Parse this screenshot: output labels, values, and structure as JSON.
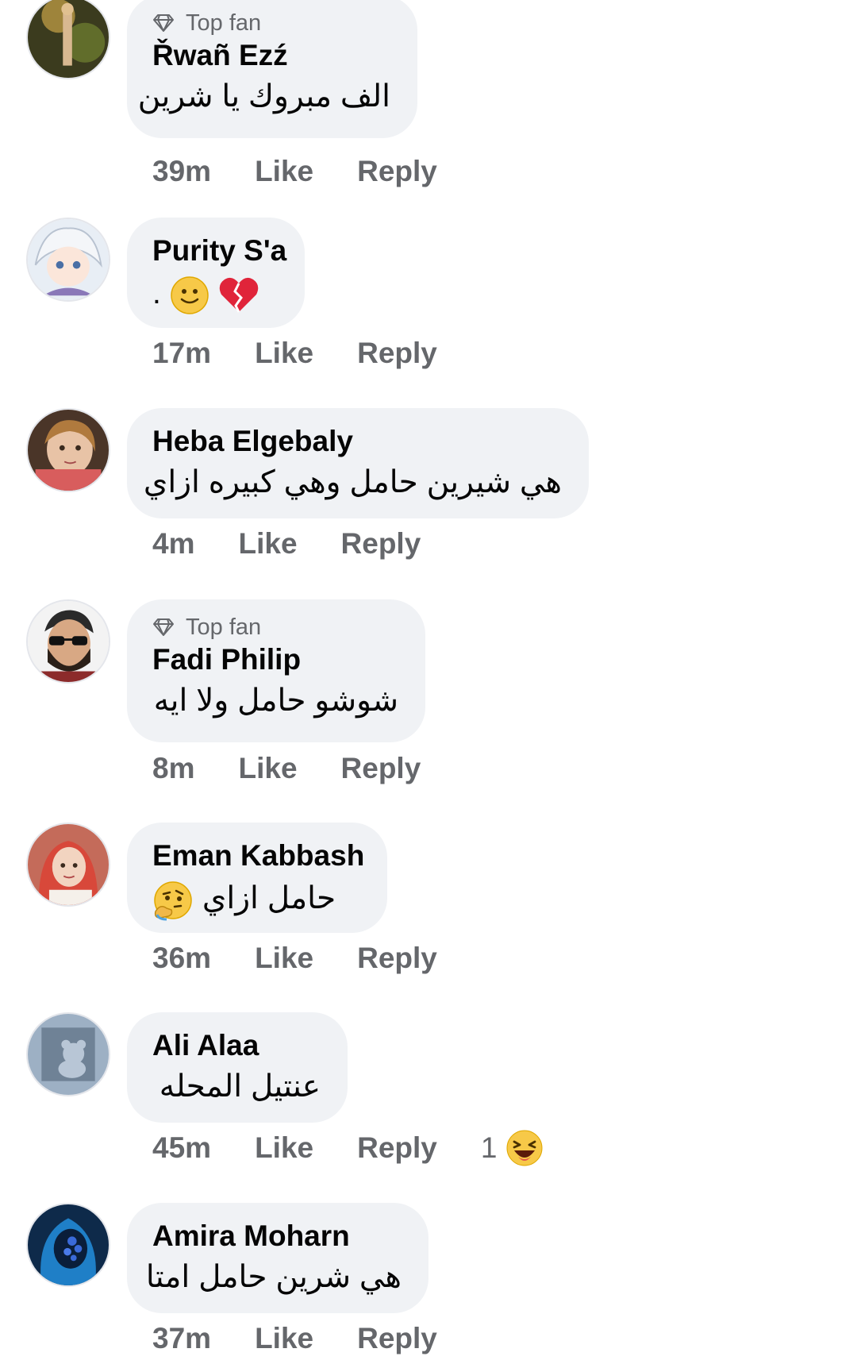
{
  "labels": {
    "top_fan": "Top fan",
    "like": "Like",
    "reply": "Reply"
  },
  "colors": {
    "bubble": "#f0f2f5",
    "meta_text": "#65676b",
    "name_text": "#050505"
  },
  "comments": [
    {
      "author": "Řwañ Ezź",
      "top_fan": true,
      "text": "الف مبروك يا شرين",
      "time": "39m",
      "avatar_icon": "user-photo-avatar"
    },
    {
      "author": "Purity S'a",
      "top_fan": false,
      "text": ".",
      "emojis": [
        "slightly-smiling-face-icon",
        "broken-heart-icon"
      ],
      "time": "17m",
      "avatar_icon": "anime-character-avatar"
    },
    {
      "author": "Heba Elgebaly",
      "top_fan": false,
      "text": "هي شيرين حامل وهي كبيره ازاي",
      "time": "4m",
      "avatar_icon": "child-photo-avatar"
    },
    {
      "author": "Fadi Philip",
      "top_fan": true,
      "text": "شوشو حامل ولا ايه",
      "time": "8m",
      "avatar_icon": "man-sunglasses-avatar"
    },
    {
      "author": "Eman Kabbash",
      "top_fan": false,
      "text": "حامل ازاي",
      "emojis": [
        "thinking-face-icon"
      ],
      "time": "36m",
      "avatar_icon": "woman-photo-avatar"
    },
    {
      "author": "Ali Alaa",
      "top_fan": false,
      "text": "عنتيل المحله",
      "time": "45m",
      "reaction_count": "1",
      "reaction_icon": "laughing-face-icon",
      "avatar_icon": "teddy-bear-avatar"
    },
    {
      "author": "Amira Moharn",
      "top_fan": false,
      "text": "هي شرين حامل امتا",
      "time": "37m",
      "avatar_icon": "hooded-figure-avatar"
    }
  ]
}
